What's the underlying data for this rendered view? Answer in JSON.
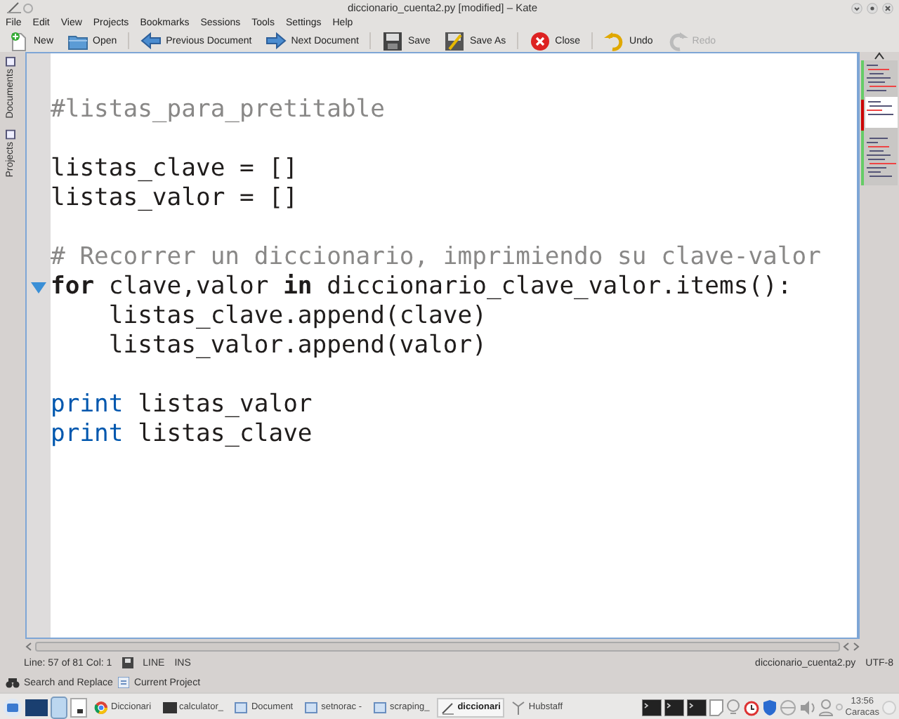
{
  "window": {
    "title": "diccionario_cuenta2.py [modified] – Kate"
  },
  "menu": [
    "File",
    "Edit",
    "View",
    "Projects",
    "Bookmarks",
    "Sessions",
    "Tools",
    "Settings",
    "Help"
  ],
  "toolbar": [
    {
      "label": "New",
      "kind": "new",
      "disabled": false
    },
    {
      "label": "Open",
      "kind": "open",
      "disabled": false
    },
    {
      "label": "Previous Document",
      "kind": "prev",
      "disabled": false
    },
    {
      "label": "Next Document",
      "kind": "next",
      "disabled": false
    },
    {
      "label": "Save",
      "kind": "save",
      "disabled": false
    },
    {
      "label": "Save As",
      "kind": "saveas",
      "disabled": false
    },
    {
      "label": "Close",
      "kind": "close",
      "disabled": false
    },
    {
      "label": "Undo",
      "kind": "undo",
      "disabled": false
    },
    {
      "label": "Redo",
      "kind": "redo",
      "disabled": true
    }
  ],
  "side_tabs": [
    {
      "label": "Documents",
      "selected": false
    },
    {
      "label": "Projects",
      "selected": false
    }
  ],
  "editor": {
    "lines": [
      {
        "kind": "blank"
      },
      {
        "kind": "code",
        "fold": false,
        "tokens": [
          {
            "kind": "comment",
            "text": "#listas_para_pretitable"
          }
        ]
      },
      {
        "kind": "blank"
      },
      {
        "kind": "code",
        "fold": false,
        "tokens": [
          {
            "kind": "text",
            "text": "listas_clave = []"
          }
        ]
      },
      {
        "kind": "code",
        "fold": false,
        "tokens": [
          {
            "kind": "text",
            "text": "listas_valor = []"
          }
        ]
      },
      {
        "kind": "blank"
      },
      {
        "kind": "code",
        "fold": false,
        "tokens": [
          {
            "kind": "comment",
            "text": "# Recorrer un diccionario, imprimiendo su clave-valor"
          }
        ]
      },
      {
        "kind": "code",
        "fold": true,
        "tokens": [
          {
            "kind": "keyword",
            "text": "for"
          },
          {
            "kind": "text",
            "text": " clave,valor "
          },
          {
            "kind": "keyword",
            "text": "in"
          },
          {
            "kind": "text",
            "text": " diccionario_clave_valor.items():"
          }
        ]
      },
      {
        "kind": "code",
        "fold": false,
        "tokens": [
          {
            "kind": "text",
            "text": "    listas_clave.append(clave)"
          }
        ]
      },
      {
        "kind": "code",
        "fold": false,
        "tokens": [
          {
            "kind": "text",
            "text": "    listas_valor.append(valor)"
          }
        ]
      },
      {
        "kind": "blank"
      },
      {
        "kind": "code",
        "fold": false,
        "tokens": [
          {
            "kind": "builtin",
            "text": "print"
          },
          {
            "kind": "text",
            "text": " listas_valor"
          }
        ]
      },
      {
        "kind": "code",
        "fold": false,
        "tokens": [
          {
            "kind": "builtin",
            "text": "print"
          },
          {
            "kind": "text",
            "text": " listas_clave"
          }
        ]
      }
    ]
  },
  "status_bar": {
    "position": "Line: 57 of 81 Col: 1",
    "mode": "LINE",
    "input": "INS",
    "file": "diccionario_cuenta2.py",
    "encoding": "UTF-8"
  },
  "tool_tabs": [
    {
      "label": "Search and Replace",
      "kind": "search"
    },
    {
      "label": "Current Project",
      "kind": "project"
    }
  ],
  "taskbar": {
    "tasks": [
      {
        "label": "Diccionari",
        "kind": "browser",
        "selected": false
      },
      {
        "label": "calculator_",
        "kind": "terminal",
        "selected": false
      },
      {
        "label": "Document",
        "kind": "folder",
        "selected": false
      },
      {
        "label": "setnorac -",
        "kind": "folder",
        "selected": false
      },
      {
        "label": "scraping_",
        "kind": "folder",
        "selected": false
      },
      {
        "label": "diccionari",
        "kind": "editor",
        "selected": true
      },
      {
        "label": "Hubstaff",
        "kind": "hubstaff",
        "selected": false
      }
    ],
    "clock": {
      "time": "13:56",
      "zone": "Caracas"
    }
  }
}
